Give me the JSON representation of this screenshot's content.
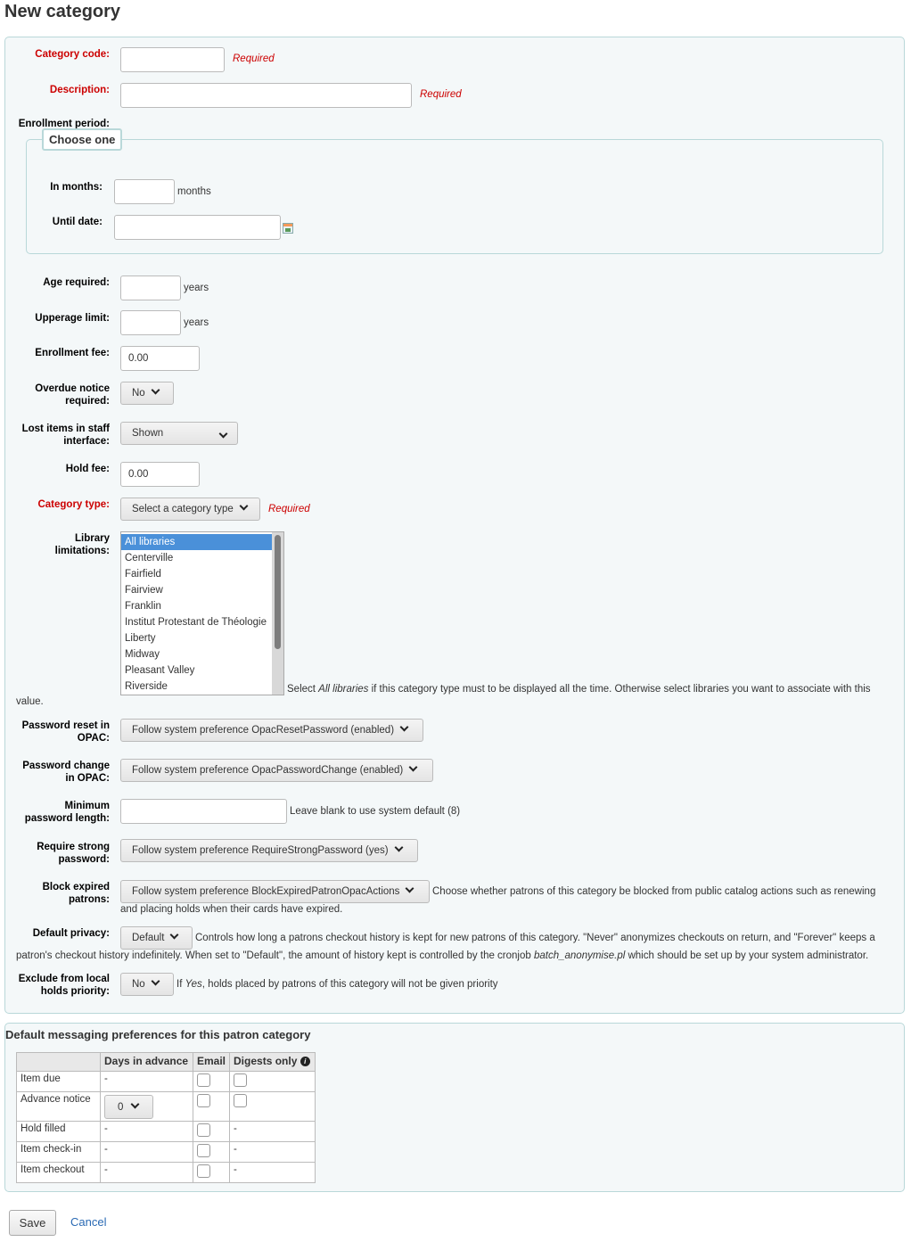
{
  "page": {
    "title": "New category"
  },
  "form": {
    "category_code": {
      "label": "Category code:",
      "value": "",
      "required": "Required"
    },
    "description": {
      "label": "Description:",
      "value": "",
      "required": "Required"
    },
    "enrollment_period": {
      "label": "Enrollment period:",
      "legend": "Choose one",
      "in_months": {
        "label": "In months:",
        "value": "",
        "unit": "months"
      },
      "until_date": {
        "label": "Until date:",
        "value": ""
      }
    },
    "age_required": {
      "label": "Age required:",
      "value": "",
      "unit": "years"
    },
    "upperage_limit": {
      "label": "Upperage limit:",
      "value": "",
      "unit": "years"
    },
    "enrollment_fee": {
      "label": "Enrollment fee:",
      "value": "0.00"
    },
    "overdue_notice": {
      "label_1": "Overdue notice",
      "label_2": "required:",
      "value": "No"
    },
    "lost_items": {
      "label_1": "Lost items in staff",
      "label_2": "interface:",
      "value": "Shown"
    },
    "hold_fee": {
      "label": "Hold fee:",
      "value": "0.00"
    },
    "category_type": {
      "label": "Category type:",
      "value": "Select a category type",
      "required": "Required"
    },
    "library_limitations": {
      "label_1": "Library",
      "label_2": "limitations:",
      "options": [
        "All libraries",
        "Centerville",
        "Fairfield",
        "Fairview",
        "Franklin",
        "Institut Protestant de Théologie",
        "Liberty",
        "Midway",
        "Pleasant Valley",
        "Riverside"
      ],
      "selected": "All libraries",
      "hint_pre": "Select ",
      "hint_em": "All libraries",
      "hint_post": " if this category type must to be displayed all the time. Otherwise select libraries you want to associate with this",
      "hint_wrap": "value."
    },
    "password_reset": {
      "label_1": "Password reset in",
      "label_2": "OPAC:",
      "value": "Follow system preference OpacResetPassword (enabled)"
    },
    "password_change": {
      "label_1": "Password change",
      "label_2": "in OPAC:",
      "value": "Follow system preference OpacPasswordChange (enabled)"
    },
    "min_password_length": {
      "label_1": "Minimum",
      "label_2": "password length:",
      "value": "",
      "hint": "Leave blank to use system default (8)"
    },
    "strong_password": {
      "label_1": "Require strong",
      "label_2": "password:",
      "value": "Follow system preference RequireStrongPassword (yes)"
    },
    "block_expired": {
      "label_1": "Block expired",
      "label_2": "patrons:",
      "value": "Follow system preference BlockExpiredPatronOpacActions",
      "hint_1": "Choose whether patrons of this category be blocked from public catalog actions such as renewing",
      "hint_2": "and placing holds when their cards have expired."
    },
    "default_privacy": {
      "label": "Default privacy:",
      "value": "Default",
      "hint_1": "Controls how long a patrons checkout history is kept for new patrons of this category. \"Never\" anonymizes checkouts on return, and \"Forever\" keeps a",
      "hint_2_pre": "patron's checkout history indefinitely. When set to \"Default\", the amount of history kept is controlled by the cronjob ",
      "hint_2_em": "batch_anonymise.pl",
      "hint_2_post": " which should be set up by your system administrator."
    },
    "exclude_local_holds": {
      "label_1": "Exclude from local",
      "label_2": "holds priority:",
      "value": "No",
      "hint_pre": "If ",
      "hint_em": "Yes",
      "hint_post": ", holds placed by patrons of this category will not be given priority"
    }
  },
  "messaging": {
    "title": "Default messaging preferences for this patron category",
    "columns": [
      "",
      "Days in advance",
      "Email",
      "Digests only"
    ],
    "rows": [
      {
        "name": "Item due",
        "days": "-",
        "email": "checkbox",
        "digest": "checkbox"
      },
      {
        "name": "Advance notice",
        "days": "0",
        "email": "checkbox",
        "digest": "checkbox"
      },
      {
        "name": "Hold filled",
        "days": "-",
        "email": "checkbox",
        "digest": "-"
      },
      {
        "name": "Item check-in",
        "days": "-",
        "email": "checkbox",
        "digest": "-"
      },
      {
        "name": "Item checkout",
        "days": "-",
        "email": "checkbox",
        "digest": "-"
      }
    ]
  },
  "actions": {
    "save": "Save",
    "cancel": "Cancel"
  }
}
